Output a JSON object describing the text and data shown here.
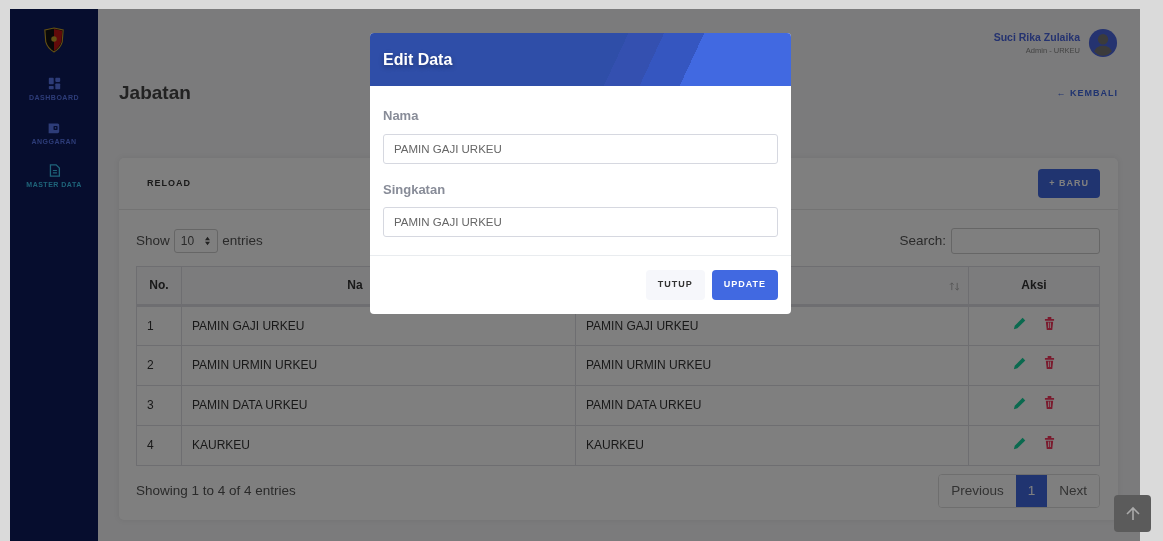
{
  "sidebar": {
    "items": [
      {
        "label": "DASHBOARD",
        "selected": false
      },
      {
        "label": "ANGGARAN",
        "selected": false
      },
      {
        "label": "MASTER DATA",
        "selected": true
      }
    ]
  },
  "user": {
    "name": "Suci Rika Zulaika",
    "role": "Admin - URKEU"
  },
  "page": {
    "title": "Jabatan",
    "back_link": "← KEMBALI"
  },
  "toolbar": {
    "reload": "RELOAD",
    "new": "+ BARU"
  },
  "table_controls": {
    "show_label": "Show",
    "page_size": "10",
    "entries_label": "entries",
    "search_label": "Search:"
  },
  "table": {
    "columns": [
      {
        "label": "No.",
        "sortable": false
      },
      {
        "label": "Na",
        "sortable": false
      },
      {
        "sortable": true
      },
      {
        "label": "Aksi",
        "sortable": false
      }
    ],
    "rows": [
      {
        "cells": [
          "1",
          "PAMIN GAJI URKEU",
          "PAMIN GAJI URKEU"
        ]
      },
      {
        "cells": [
          "2",
          "PAMIN URMIN URKEU",
          "PAMIN URMIN URKEU"
        ]
      },
      {
        "cells": [
          "3",
          "PAMIN DATA URKEU",
          "PAMIN DATA URKEU"
        ]
      },
      {
        "cells": [
          "4",
          "KAURKEU",
          "KAURKEU"
        ]
      }
    ]
  },
  "footer": {
    "info": "Showing 1 to 4 of 4 entries",
    "pagination": [
      {
        "label": "Previous",
        "selected": false
      },
      {
        "label": "1",
        "selected": true
      },
      {
        "label": "Next",
        "selected": false
      }
    ]
  },
  "modal": {
    "title": "Edit Data",
    "fields": [
      {
        "label": "Nama",
        "value": "PAMIN GAJI URKEU"
      },
      {
        "label": "Singkatan",
        "value": "PAMIN GAJI URKEU"
      }
    ],
    "buttons": [
      {
        "label": "TUTUP",
        "kind": "secondary"
      },
      {
        "label": "UPDATE",
        "kind": "primary"
      }
    ]
  }
}
